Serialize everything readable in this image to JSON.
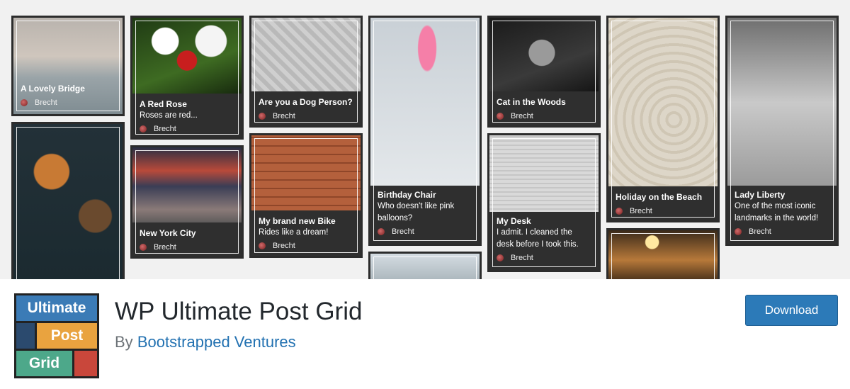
{
  "banner": {
    "cards": [
      {
        "title": "A Lovely Bridge",
        "text": "",
        "author": "Brecht",
        "image": "bridge-photo"
      },
      {
        "title": "A Red Rose",
        "text": "Roses are red...",
        "author": "Brecht",
        "image": "rose-photo"
      },
      {
        "title": "Are you a Dog Person?",
        "text": "",
        "author": "Brecht",
        "image": "dog-photo"
      },
      {
        "title": "Birthday Chair",
        "text": "Who doesn't like pink balloons?",
        "author": "Brecht",
        "image": "balloon-chair-photo"
      },
      {
        "title": "Cat in the Woods",
        "text": "",
        "author": "Brecht",
        "image": "cat-photo"
      },
      {
        "title": "Holiday on the Beach",
        "text": "",
        "author": "Brecht",
        "image": "beach-photo"
      },
      {
        "title": "Lady Liberty",
        "text": "One of the most iconic landmarks in the world!",
        "author": "Brecht",
        "image": "statue-of-liberty-photo"
      },
      {
        "title": "New York City",
        "text": "",
        "author": "Brecht",
        "image": "times-square-photo"
      },
      {
        "title": "My brand new Bike",
        "text": "Rides like a dream!",
        "author": "Brecht",
        "image": "bike-photo"
      },
      {
        "title": "My Desk",
        "text": "I admit. I cleaned the desk before I took this.",
        "author": "Brecht",
        "image": "desk-photo"
      }
    ]
  },
  "logo": {
    "word1": "Ultimate",
    "word2": "Post",
    "word3": "Grid",
    "colors": {
      "blue": "#3b7bb6",
      "orange": "#e9a33f",
      "green": "#4da88a",
      "red": "#c9473b",
      "navy": "#2b4a6e"
    }
  },
  "plugin": {
    "title": "WP Ultimate Post Grid",
    "by": "By",
    "author": "Bootstrapped Ventures"
  },
  "actions": {
    "download_label": "Download"
  }
}
